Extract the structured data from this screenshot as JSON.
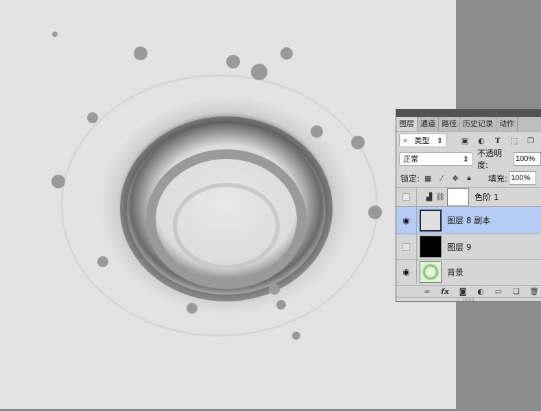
{
  "panel": {
    "tabs": [
      {
        "label": "图层",
        "active": true
      },
      {
        "label": "通道"
      },
      {
        "label": "路径"
      },
      {
        "label": "历史记录"
      },
      {
        "label": "动作"
      }
    ],
    "filter": {
      "label": "类型",
      "icons": [
        "image-filter-icon",
        "adjustment-filter-icon",
        "text-filter-icon",
        "shape-filter-icon",
        "smart-object-filter-icon"
      ]
    },
    "blend_mode": "正常",
    "opacity_label": "不透明度:",
    "opacity": "100%",
    "lock_label": "锁定:",
    "fill_label": "填充:",
    "fill": "100%",
    "layers": [
      {
        "name": "色阶 1",
        "visible": false,
        "type": "levels-adjustment"
      },
      {
        "name": "图层 8 副本",
        "visible": true,
        "selected": true
      },
      {
        "name": "图层 9",
        "visible": false
      },
      {
        "name": "背景",
        "visible": true
      }
    ],
    "selected_color": "#b7ccf4"
  }
}
